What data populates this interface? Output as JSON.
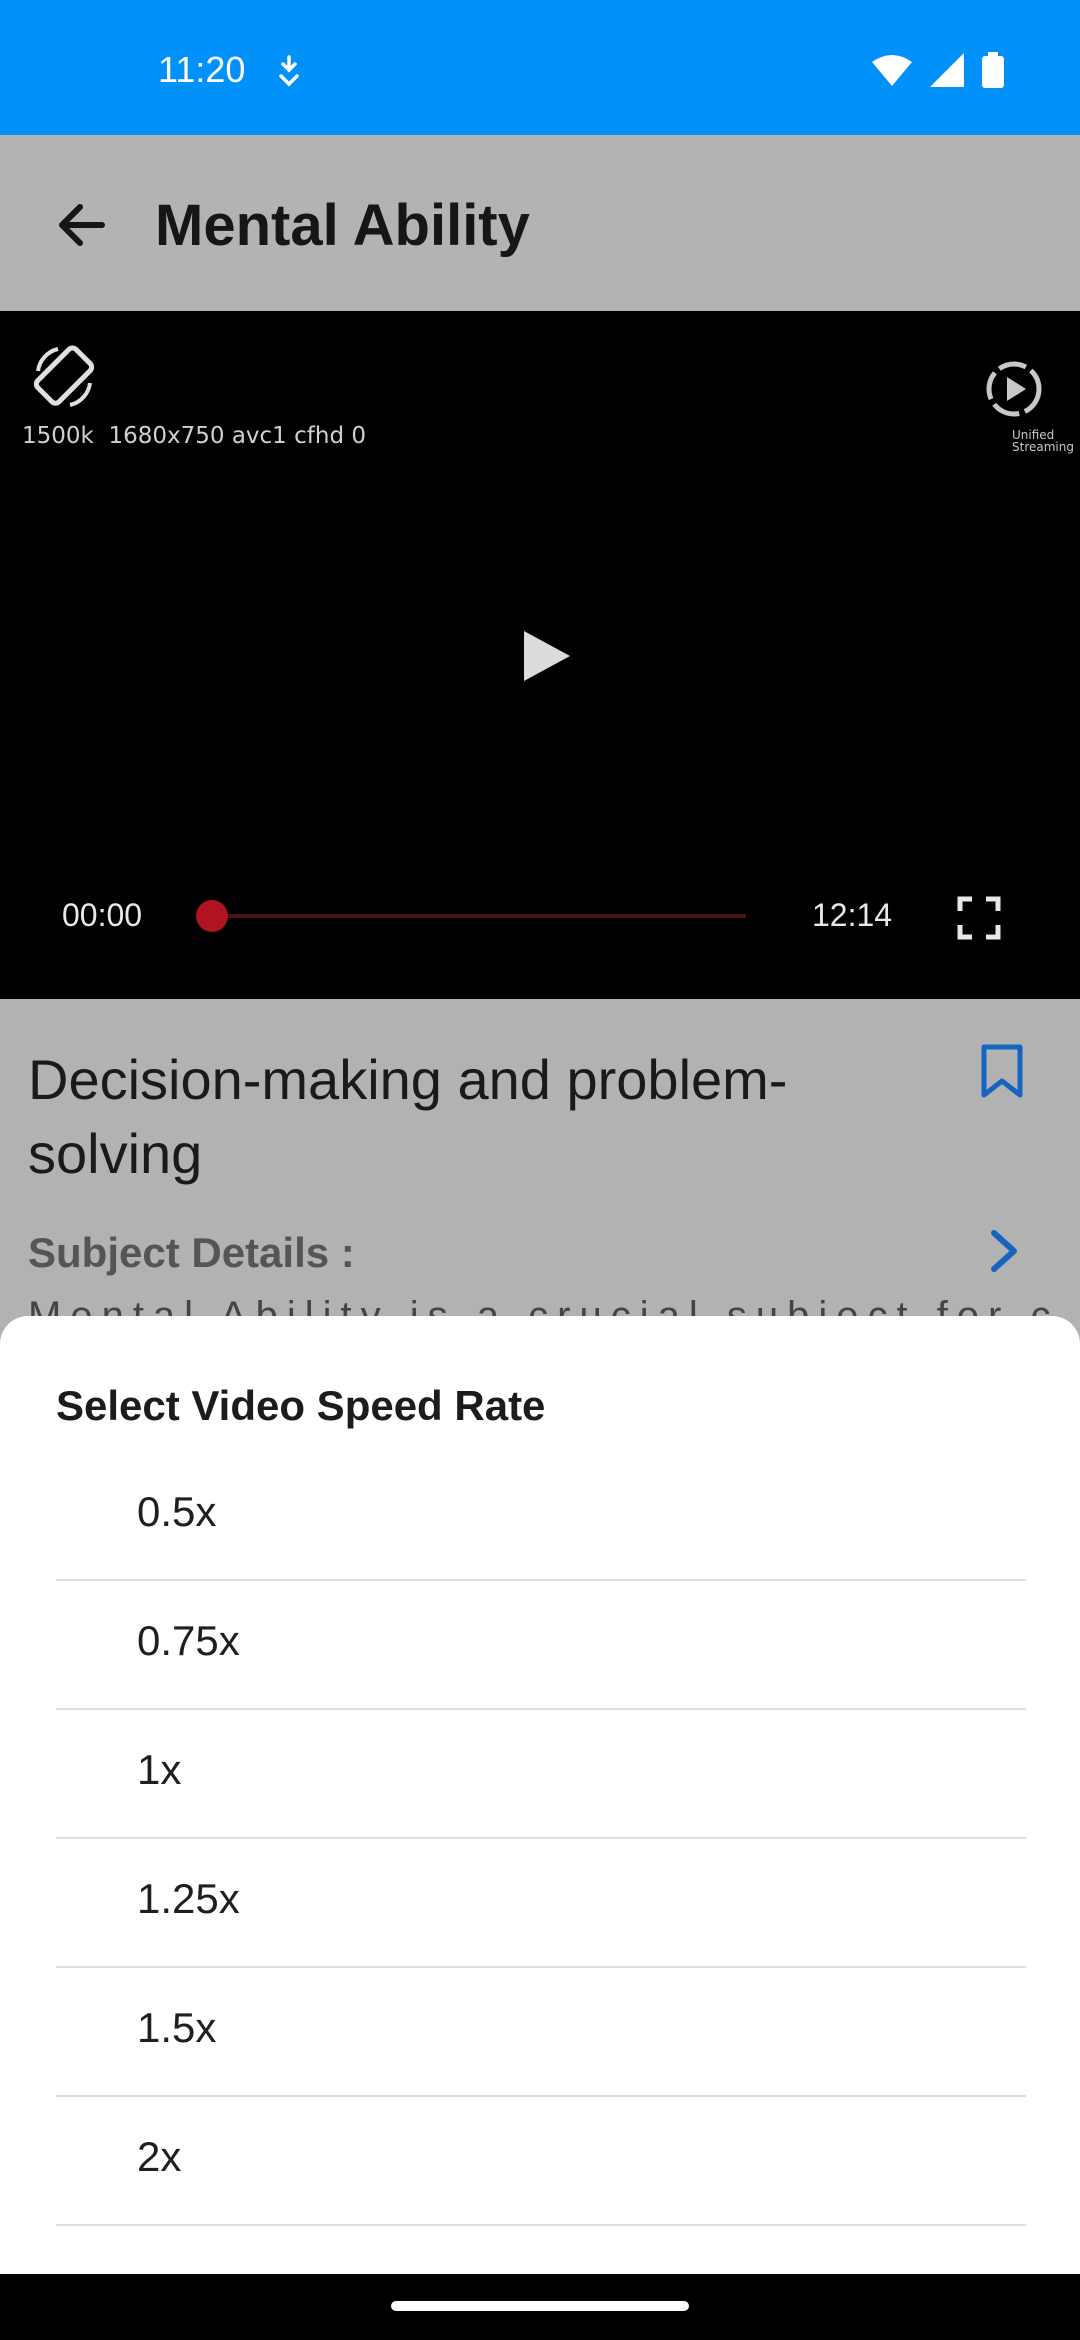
{
  "status_bar": {
    "time": "11:20",
    "icons": [
      "download-status-icon",
      "wifi-icon",
      "cellular-signal-icon",
      "battery-icon"
    ]
  },
  "appbar": {
    "title": "Mental Ability",
    "back_icon": "arrow-back-icon"
  },
  "player": {
    "debug_info": "1500k  1680x750 avc1 cfhd 0",
    "logo_text": [
      "Unified",
      "Streaming"
    ],
    "current_time": "00:00",
    "total_time": "12:14",
    "progress": 0,
    "colors": {
      "seek_thumb": "#b0141e",
      "background": "#000000"
    }
  },
  "details": {
    "title": "Decision-making and problem-solving",
    "subject_label": "Subject Details :",
    "subject_text": "Mental Ability is a crucial subject for candidates"
  },
  "speed_sheet": {
    "title": "Select Video Speed Rate",
    "options": [
      "0.5x",
      "0.75x",
      "1x",
      "1.25x",
      "1.5x",
      "2x"
    ]
  },
  "colors": {
    "status_bar": "#0091fb",
    "accent": "#1565c0",
    "scrim": "#b2b2b2"
  }
}
